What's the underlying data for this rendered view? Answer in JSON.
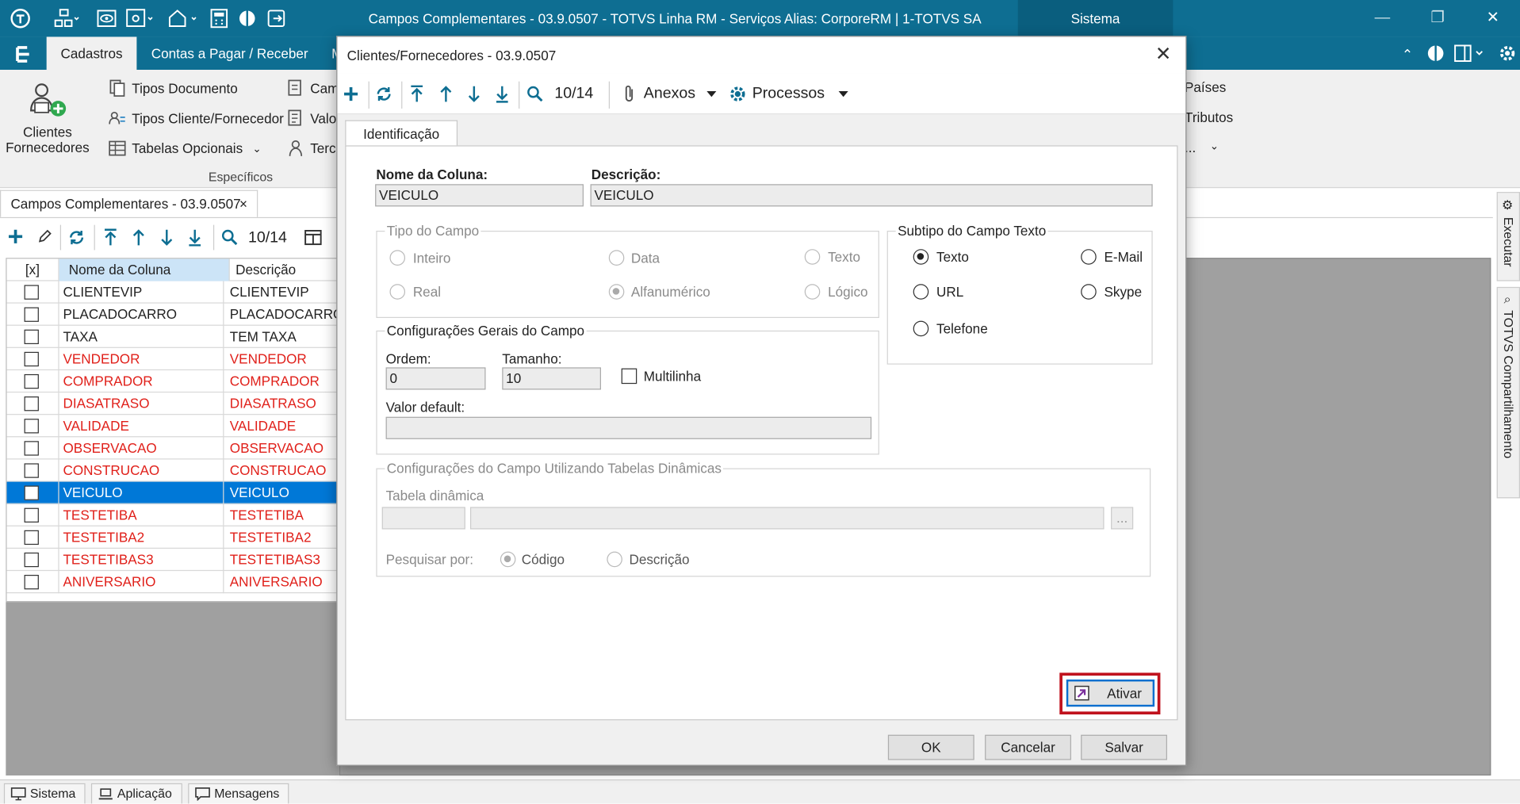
{
  "window": {
    "title": "Campos Complementares - 03.9.0507 - TOTVS Linha RM - Serviços  Alias: CorporeRM | 1-TOTVS SA",
    "sistema_label": "Sistema"
  },
  "ribbon": {
    "tabs": [
      "Cadastros",
      "Contas a Pagar / Receber",
      "M"
    ],
    "big_button": {
      "line1": "Clientes",
      "line2": "Fornecedores"
    },
    "items": [
      "Tipos Documento",
      "Tipos Cliente/Fornecedor",
      "Tabelas Opcionais",
      "Camp",
      "Valor",
      "Terc"
    ],
    "right_items": [
      "Países",
      "Tributos",
      "..."
    ],
    "group_label": "Específicos"
  },
  "doc_tab": {
    "title": "Campos Complementares - 03.9.0507",
    "close": "×"
  },
  "grid_toolbar": {
    "record": "10/14"
  },
  "grid": {
    "headers": [
      "[x]",
      "Nome da Coluna",
      "Descrição"
    ],
    "rows": [
      {
        "nome": "CLIENTEVIP",
        "desc": "CLIENTEVIP",
        "style": "normal"
      },
      {
        "nome": "PLACADOCARRO",
        "desc": "PLACADOCARRO",
        "style": "normal"
      },
      {
        "nome": "TAXA",
        "desc": "TEM TAXA",
        "style": "normal"
      },
      {
        "nome": "VENDEDOR",
        "desc": "VENDEDOR",
        "style": "red"
      },
      {
        "nome": "COMPRADOR",
        "desc": "COMPRADOR",
        "style": "red"
      },
      {
        "nome": "DIASATRASO",
        "desc": "DIASATRASO",
        "style": "red"
      },
      {
        "nome": "VALIDADE",
        "desc": "VALIDADE",
        "style": "red"
      },
      {
        "nome": "OBSERVACAO",
        "desc": "OBSERVACAO",
        "style": "red"
      },
      {
        "nome": "CONSTRUCAO",
        "desc": "CONSTRUCAO",
        "style": "red"
      },
      {
        "nome": "VEICULO",
        "desc": "VEICULO",
        "style": "selected"
      },
      {
        "nome": "TESTETIBA",
        "desc": "TESTETIBA",
        "style": "red"
      },
      {
        "nome": "TESTETIBA2",
        "desc": "TESTETIBA2",
        "style": "red"
      },
      {
        "nome": "TESTETIBAS3",
        "desc": "TESTETIBAS3",
        "style": "red"
      },
      {
        "nome": "ANIVERSARIO",
        "desc": "ANIVERSARIO",
        "style": "red"
      }
    ]
  },
  "side_tabs": [
    "Executar",
    "TOTVS Compartilhamento"
  ],
  "statusbar": {
    "tabs": [
      "Sistema",
      "Aplicação",
      "Mensagens"
    ]
  },
  "dialog": {
    "title": "Clientes/Fornecedores - 03.9.0507",
    "close": "✕",
    "toolbar": {
      "record": "10/14",
      "anexos": "Anexos",
      "processos": "Processos"
    },
    "tab": "Identificação",
    "nome_coluna_label": "Nome da Coluna:",
    "nome_coluna_value": "VEICULO",
    "descricao_label": "Descrição:",
    "descricao_value": "VEICULO",
    "tipo_campo": {
      "title": "Tipo do Campo",
      "options": [
        "Inteiro",
        "Data",
        "Texto",
        "Real",
        "Alfanumérico",
        "Lógico"
      ],
      "selected": "Alfanumérico"
    },
    "subtipo": {
      "title": "Subtipo do Campo Texto",
      "options": [
        "Texto",
        "E-Mail",
        "URL",
        "Skype",
        "Telefone"
      ],
      "selected": "Texto"
    },
    "config_gerais": {
      "title": "Configurações Gerais do Campo",
      "ordem_label": "Ordem:",
      "ordem_value": "0",
      "tamanho_label": "Tamanho:",
      "tamanho_value": "10",
      "multilinha_label": "Multilinha",
      "multilinha_checked": false,
      "valor_default_label": "Valor default:",
      "valor_default_value": ""
    },
    "config_dinamicas": {
      "title": "Configurações do Campo Utilizando Tabelas Dinâmicas",
      "tabela_label": "Tabela dinâmica",
      "browse": "...",
      "pesquisar_label": "Pesquisar por:",
      "options": [
        "Código",
        "Descrição"
      ],
      "selected": "Código"
    },
    "ativar_label": "Ativar",
    "buttons": [
      "OK",
      "Cancelar",
      "Salvar"
    ]
  },
  "colors": {
    "titlebar": "#0e6e92",
    "selected_row": "#0078d7",
    "red_text": "#e0201a",
    "highlight": "#c0121d"
  }
}
